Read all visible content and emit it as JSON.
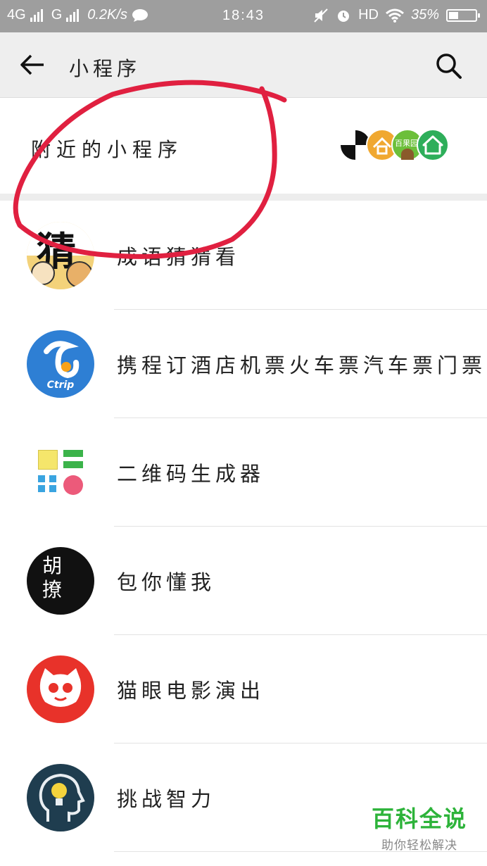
{
  "status_bar": {
    "network1": "4G",
    "network2": "G",
    "speed": "0.2K/s",
    "time": "18:43",
    "hd": "HD",
    "battery": "35%",
    "battery_level": 0.35
  },
  "header": {
    "title": "小程序",
    "back_icon": "arrow-left-icon",
    "search_icon": "search-icon"
  },
  "nearby": {
    "label": "附近的小程序",
    "icon_text": "百果园"
  },
  "list": [
    {
      "label": "成语猜猜看",
      "icon": "idiom-guess-icon",
      "icon_text": "猜"
    },
    {
      "label": "携程订酒店机票火车票汽车票门票",
      "icon": "ctrip-icon",
      "icon_text": "Ctrip"
    },
    {
      "label": "二维码生成器",
      "icon": "qr-generator-icon"
    },
    {
      "label": "包你懂我",
      "icon": "hu-liao-icon",
      "icon_text": "胡撩"
    },
    {
      "label": "猫眼电影演出",
      "icon": "maoyan-cat-icon"
    },
    {
      "label": "挑战智力",
      "icon": "brain-bulb-icon"
    }
  ],
  "watermark": {
    "title": "百科全说",
    "subtitle": "助你轻松解决"
  },
  "colors": {
    "annotation": "#e02040",
    "watermark": "#2db33a"
  }
}
